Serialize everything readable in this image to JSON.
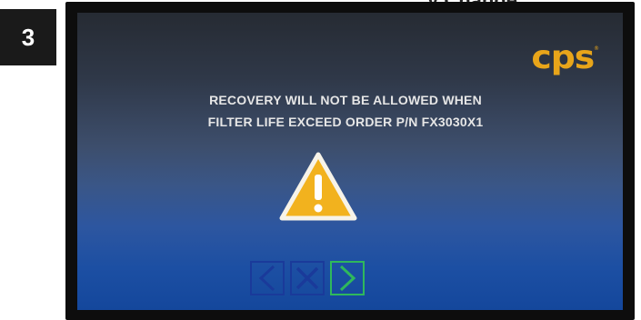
{
  "step_number": "3",
  "header_caption": "y Change",
  "screen": {
    "logo": {
      "text": "cps",
      "trademark": "®"
    },
    "message": {
      "line1": "RECOVERY WILL NOT BE ALLOWED WHEN",
      "line2": "FILTER LIFE EXCEED ORDER P/N FX3030X1"
    },
    "icons": {
      "warning": "warning-triangle-icon",
      "back": "chevron-left-icon",
      "cancel": "close-x-icon",
      "next": "chevron-right-icon"
    }
  },
  "colors": {
    "logo": "#e8a51a",
    "warning_fill": "#f2b21e",
    "nav_blue": "#1a3a9a",
    "nav_green": "#2fb85c",
    "message_text": "#e6e6e6"
  }
}
